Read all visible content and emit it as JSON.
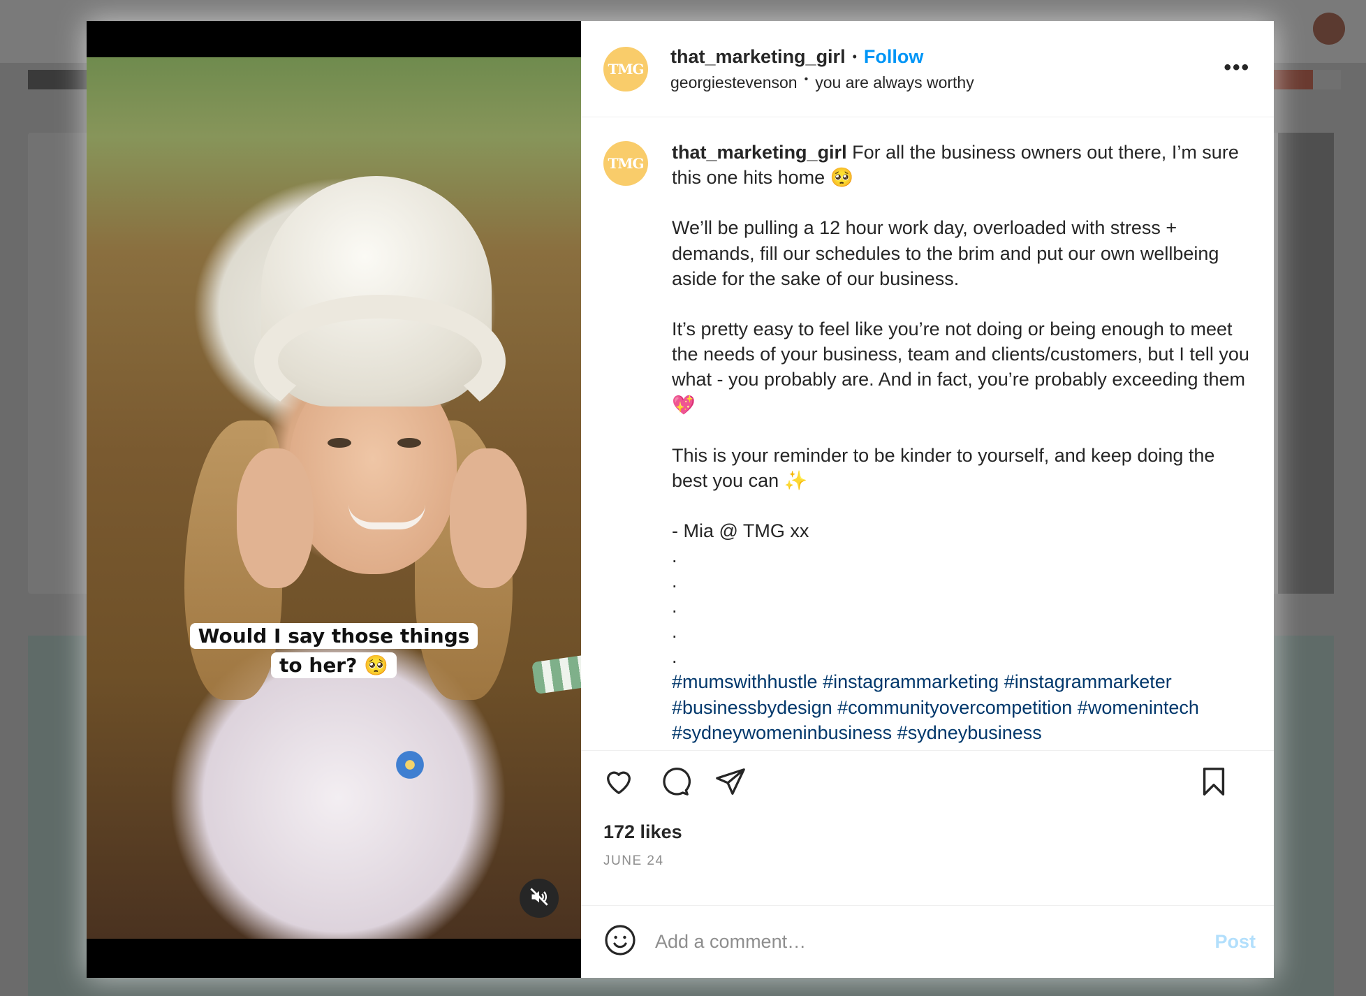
{
  "post": {
    "username": "that_marketing_girl",
    "separator": "•",
    "follow_label": "Follow",
    "audio_artist": "georgiestevenson",
    "audio_dot": "•",
    "audio_title": "you are always worthy",
    "avatar_text": "TMG",
    "more_label": "•••",
    "overlay_line1": "Would I say those things",
    "overlay_line2": "to her? 🥺",
    "caption": {
      "username": "that_marketing_girl",
      "intro": " For all the business owners out there, I’m sure this one hits home 🥺",
      "para1": "We’ll be pulling a 12 hour work day, overloaded with stress + demands, fill our schedules to the brim and put our own wellbeing aside for the sake of our business.",
      "para2": "It’s pretty easy to feel like you’re not doing or being enough to meet the needs of your business, team and clients/customers, but I tell you what - you probably are. And in fact, you’re probably exceeding them 💖",
      "para3": "This is your reminder to be kinder to yourself, and keep doing the best you can ✨",
      "signoff": "- Mia @ TMG xx",
      "dot": ".",
      "hashtags": "#mumswithhustle #instagrammarketing #instagrammarketer #businessbydesign #communityovercompetition #womenintech #sydneywomeninbusiness #sydneybusiness"
    },
    "likes": "172 likes",
    "date": "JUNE 24",
    "comment_placeholder": "Add a comment…",
    "post_label": "Post"
  },
  "icons": {
    "like": "heart-icon",
    "comment": "comment-icon",
    "share": "share-icon",
    "save": "bookmark-icon",
    "emoji": "emoji-icon",
    "mute": "muted-speaker-icon"
  },
  "colors": {
    "follow_blue": "#0095f6",
    "hashtag_blue": "#00376b",
    "post_disabled": "#b2dffc",
    "avatar_yellow": "#f9cc6a"
  }
}
